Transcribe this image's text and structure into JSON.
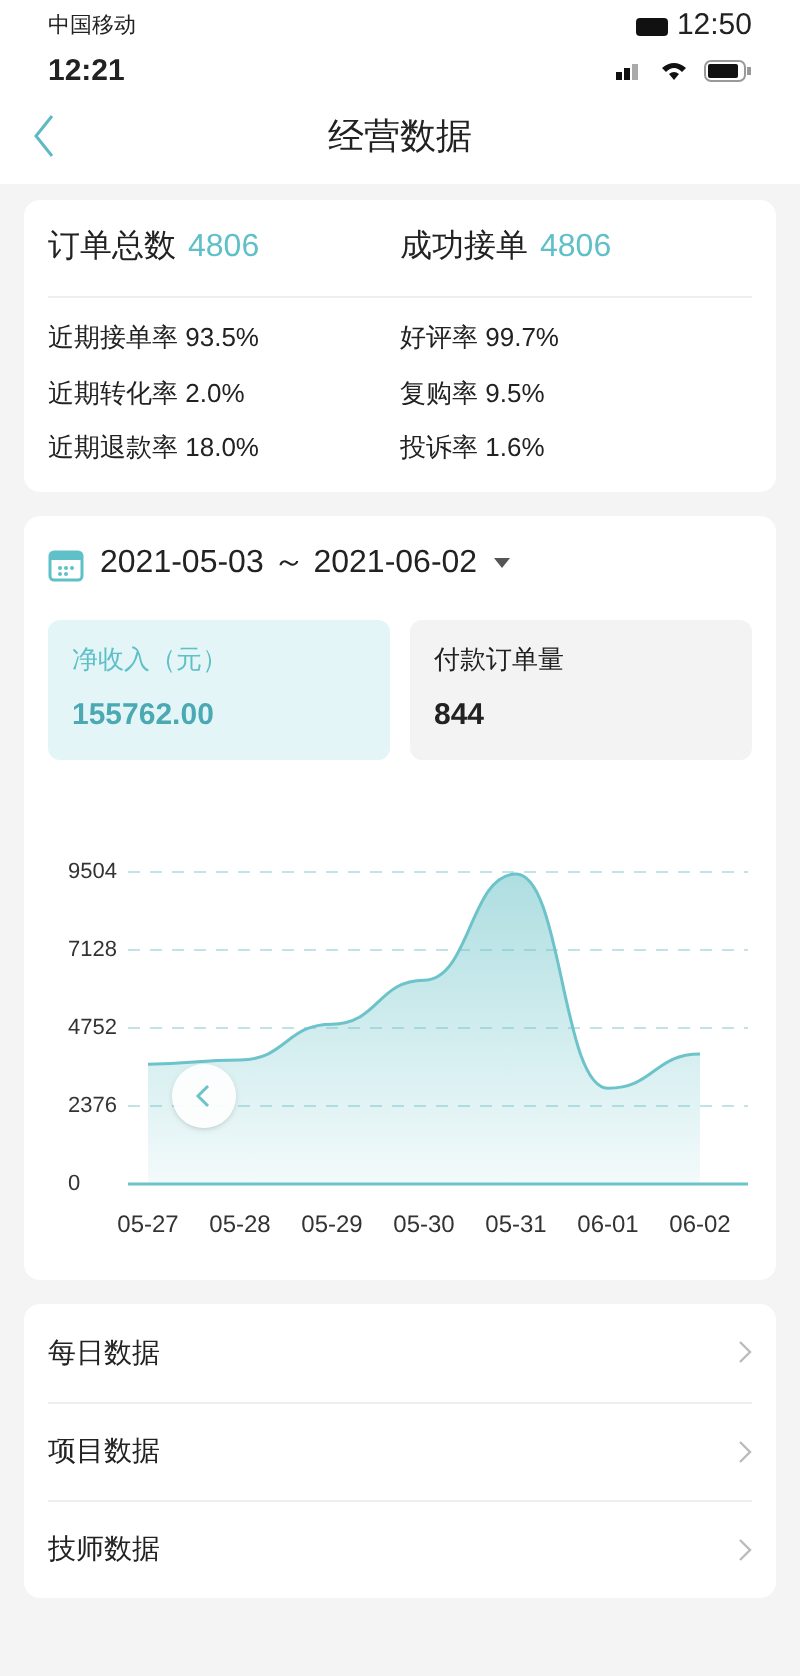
{
  "status_bar": {
    "carrier": "中国移动",
    "time": "12:50",
    "time_under": "12:21"
  },
  "nav": {
    "title": "经营数据"
  },
  "summary": {
    "totals": [
      {
        "label": "订单总数",
        "value": "4806"
      },
      {
        "label": "成功接单",
        "value": "4806"
      }
    ],
    "rates": [
      {
        "label": "近期接单率",
        "value": "93.5%"
      },
      {
        "label": "好评率",
        "value": "99.7%"
      },
      {
        "label": "近期转化率",
        "value": "2.0%"
      },
      {
        "label": "复购率",
        "value": "9.5%"
      },
      {
        "label": "近期退款率",
        "value": "18.0%"
      },
      {
        "label": "投诉率",
        "value": "1.6%"
      }
    ]
  },
  "date_range": {
    "text": "2021-05-03 ～ 2021-06-02"
  },
  "metrics": [
    {
      "label": "净收入（元）",
      "value": "155762.00",
      "selected": true
    },
    {
      "label": "付款订单量",
      "value": "844",
      "selected": false
    }
  ],
  "chart_data": {
    "type": "area",
    "categories": [
      "05-27",
      "05-28",
      "05-29",
      "05-30",
      "05-31",
      "06-01",
      "06-02"
    ],
    "yticks": [
      0,
      2376,
      4752,
      7128,
      9504
    ],
    "ylim": [
      0,
      9504
    ],
    "grid": true,
    "series": [
      {
        "color": "#6cc3c9",
        "values": [
          3650,
          3780,
          4870,
          6210,
          9440,
          2920,
          3960
        ]
      }
    ]
  },
  "menu": [
    {
      "label": "每日数据"
    },
    {
      "label": "项目数据"
    },
    {
      "label": "技师数据"
    }
  ]
}
